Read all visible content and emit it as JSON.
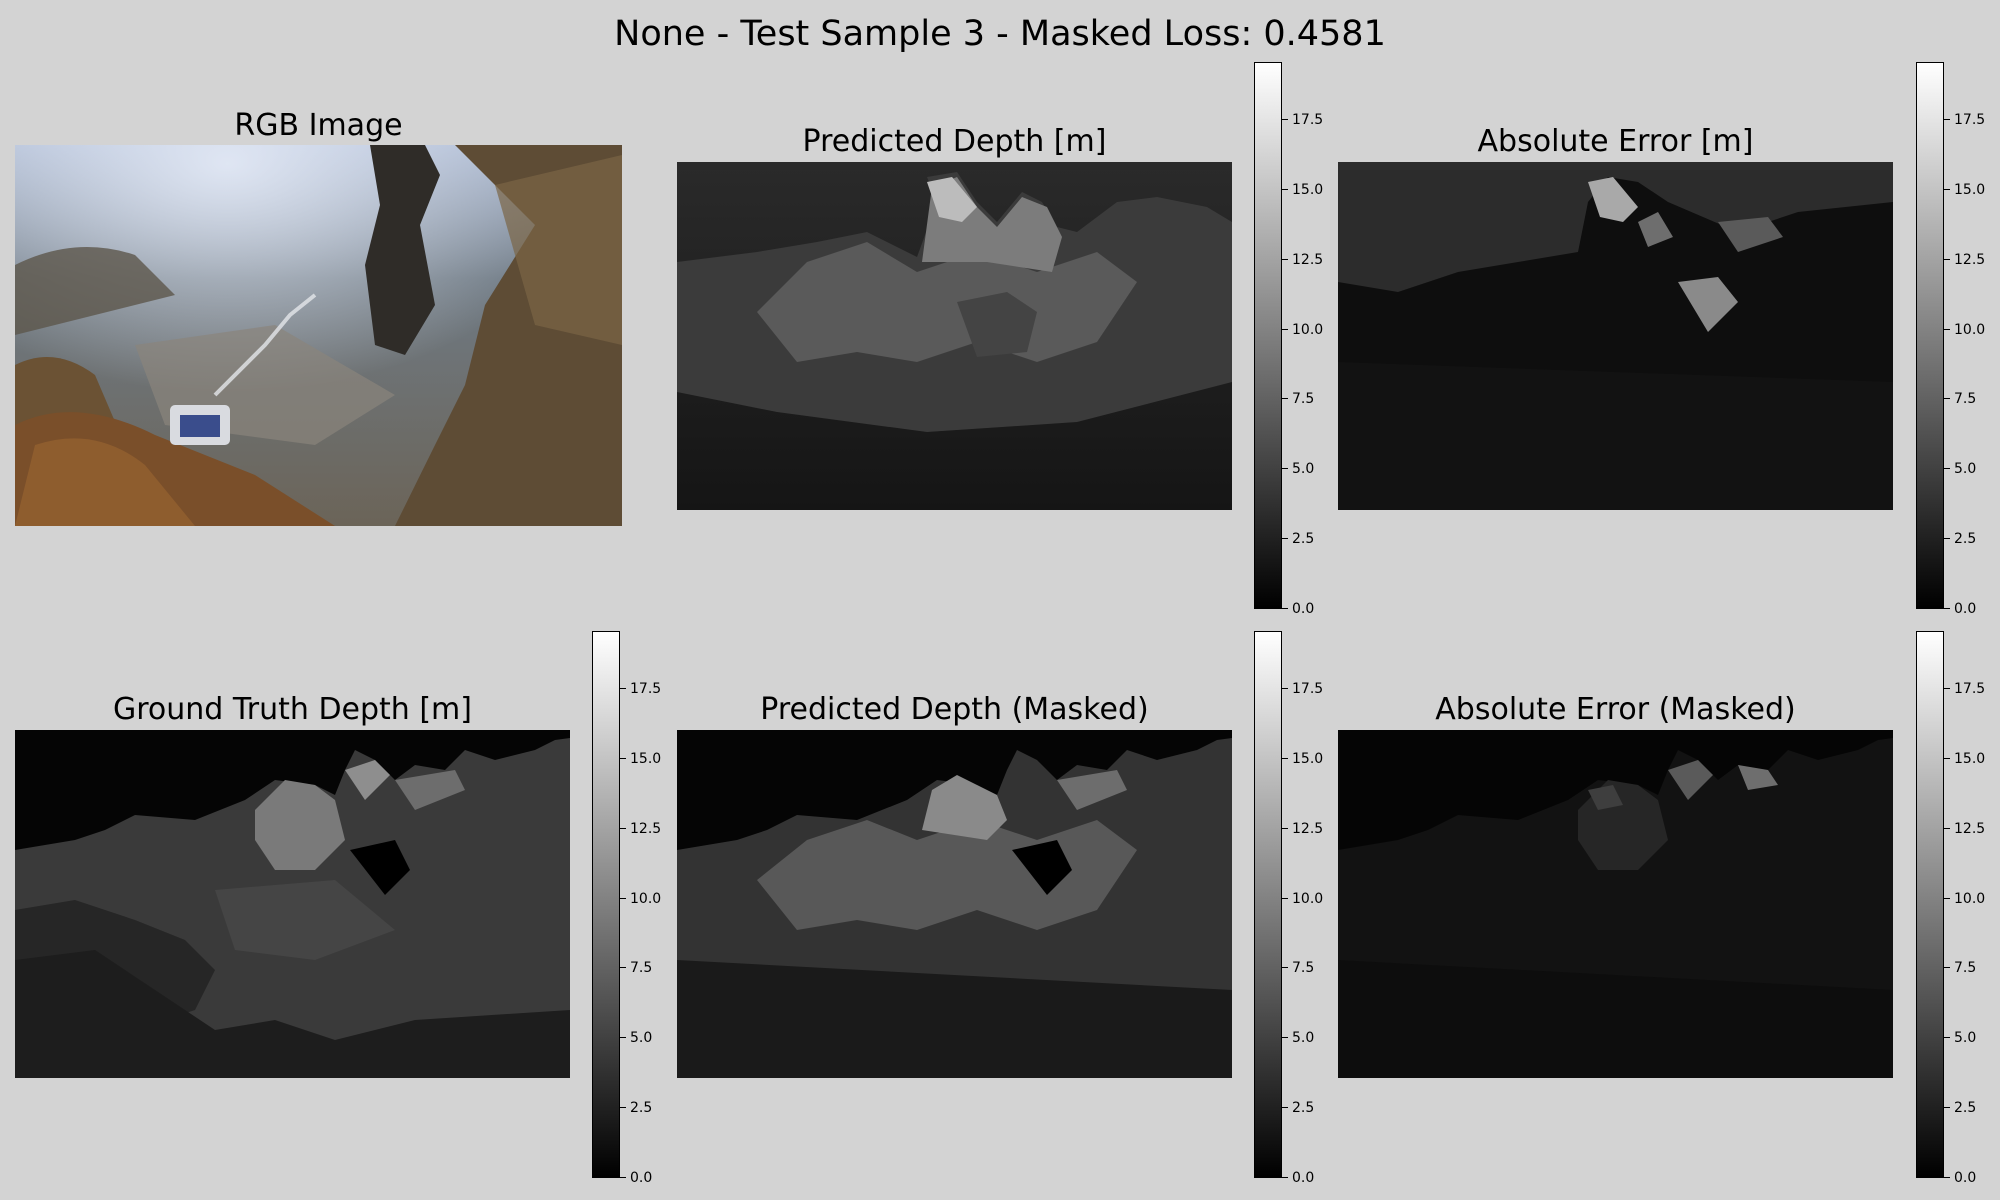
{
  "figure": {
    "title": "None - Test Sample 3 - Masked Loss: 0.4581"
  },
  "panels": [
    {
      "title": "RGB Image"
    },
    {
      "title": "Predicted Depth [m]"
    },
    {
      "title": "Absolute Error [m]"
    },
    {
      "title": "Ground Truth Depth [m]"
    },
    {
      "title": "Predicted Depth (Masked)"
    },
    {
      "title": "Absolute Error (Masked)"
    }
  ],
  "colorbar": {
    "colormap": "gray",
    "range": [
      0,
      19.5
    ],
    "ticks": [
      "0.0",
      "2.5",
      "5.0",
      "7.5",
      "10.0",
      "12.5",
      "15.0",
      "17.5"
    ]
  }
}
